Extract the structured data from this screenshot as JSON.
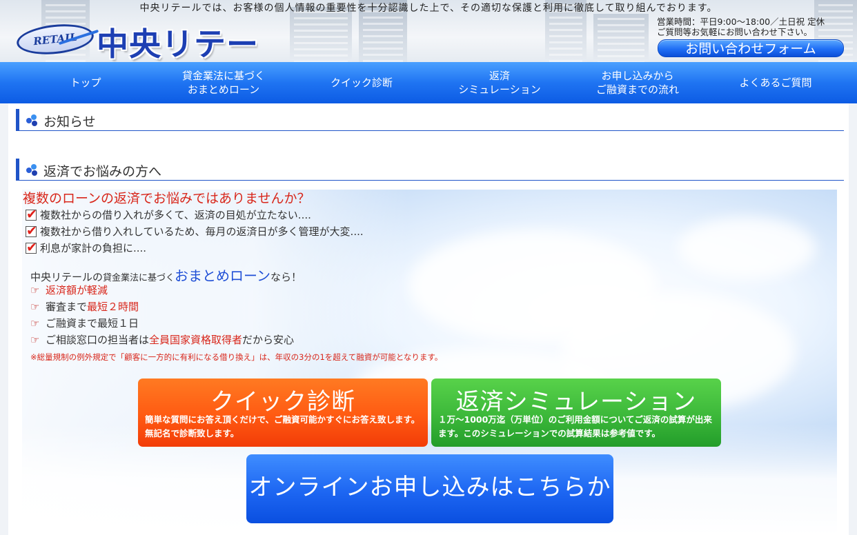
{
  "header": {
    "privacy_notice": "中央リテールでは、お客様の個人情報の重要性を十分認識した上で、その適切な保護と利用に徹底して取り組んでおります。",
    "logo_mark": "RETAIL",
    "logo_text": "中央リテール",
    "hours_line1": "営業時間：平日9:00～18:00／土日祝 定休",
    "hours_line2": "ご質問等お気軽にお問い合わせ下さい。",
    "contact_button": "お問い合わせフォーム"
  },
  "nav": {
    "items": [
      {
        "label": "トップ"
      },
      {
        "label": "貸金業法に基づく\nおまとめローン"
      },
      {
        "label": "クイック診断"
      },
      {
        "label": "返済\nシミュレーション"
      },
      {
        "label": "お申し込みから\nご融資までの流れ"
      },
      {
        "label": "よくあるご質問"
      }
    ]
  },
  "sections": {
    "news_title": "お知らせ",
    "repay_title": "返済でお悩みの方へ"
  },
  "hero": {
    "question": "複数のローンの返済でお悩みではありませんか？",
    "checks": [
      "複数社からの借り入れが多くて、返済の目処が立たない....",
      "複数社から借り入れしているため、毎月の返済日が多く管理が大変....",
      "利息が家計の負担に...."
    ],
    "lead_prefix": "中央リテールの",
    "lead_small": "貸金業法に基づく",
    "lead_big": "おまとめローン",
    "lead_suffix": "なら！",
    "point1": "返済額が軽減",
    "point2_pre": "審査まで",
    "point2_red": "最短２時間",
    "point3": "ご融資まで最短１日",
    "point4_pre": "ご相談窓口の担当者は",
    "point4_red": "全員国家資格取得者",
    "point4_post": "だから安心",
    "note": "※総量規制の例外規定で「顧客に一方的に有利になる借り換え」は、年収の3分の1を超えて融資が可能となります。"
  },
  "buttons": {
    "quick_title": "クイック診断",
    "quick_desc": "簡単な質問にお答え頂くだけで、ご融資可能かすぐにお答え致します。無記名で診断致します。",
    "sim_title": "返済シミュレーション",
    "sim_desc": "１万～1000万迄（万単位）のご利用金額についてご返済の試算が出来ます。このシミュレーションでの試算結果は参考値です。",
    "online": "オンラインお申し込みはこちらから"
  },
  "colors": {
    "nav_blue": "#1f74f2",
    "accent_red": "#d8261a",
    "quick_orange": "#ff5a12",
    "sim_green": "#3cb83a"
  }
}
